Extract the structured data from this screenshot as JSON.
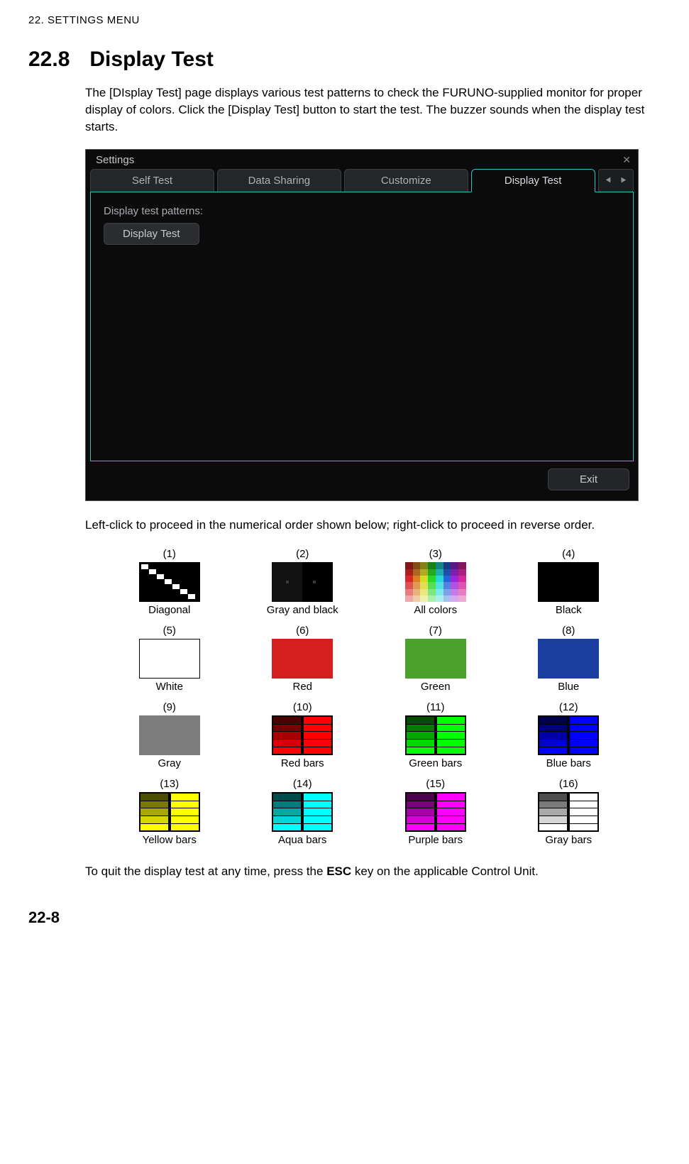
{
  "chapter_header": "22.  SETTINGS MENU",
  "section": {
    "num": "22.8",
    "title": "Display Test"
  },
  "para1": "The [DIsplay Test] page displays various test patterns to check the FURUNO-supplied monitor for proper display of colors. Click the [Display Test] button to start the test. The buzzer sounds when the display test starts.",
  "para2": "Left-click to proceed in the numerical order shown below; right-click to proceed in reverse order.",
  "para3_pre": "To quit the display test at any time, press the ",
  "para3_esc": "ESC",
  "para3_post": " key on the applicable Control Unit.",
  "window": {
    "title": "Settings",
    "tabs": [
      "Self Test",
      "Data Sharing",
      "Customize",
      "Display Test"
    ],
    "active_tab": "Display Test",
    "panel_label": "Display test patterns:",
    "button": "Display Test",
    "exit": "Exit"
  },
  "patterns": [
    {
      "num": "(1)",
      "caption": "Diagonal"
    },
    {
      "num": "(2)",
      "caption": "Gray and black"
    },
    {
      "num": "(3)",
      "caption": "All colors"
    },
    {
      "num": "(4)",
      "caption": "Black"
    },
    {
      "num": "(5)",
      "caption": "White"
    },
    {
      "num": "(6)",
      "caption": "Red"
    },
    {
      "num": "(7)",
      "caption": "Green"
    },
    {
      "num": "(8)",
      "caption": "Blue"
    },
    {
      "num": "(9)",
      "caption": "Gray"
    },
    {
      "num": "(10)",
      "caption": "Red bars"
    },
    {
      "num": "(11)",
      "caption": "Green bars"
    },
    {
      "num": "(12)",
      "caption": "Blue bars"
    },
    {
      "num": "(13)",
      "caption": "Yellow bars"
    },
    {
      "num": "(14)",
      "caption": "Aqua bars"
    },
    {
      "num": "(15)",
      "caption": "Purple bars"
    },
    {
      "num": "(16)",
      "caption": "Gray bars"
    }
  ],
  "colors": {
    "black": "#000000",
    "white": "#ffffff",
    "red": "#d51f1f",
    "green": "#4aa22c",
    "blue": "#1b3fa0",
    "gray": "#7c7c7c"
  },
  "page_number": "22-8"
}
